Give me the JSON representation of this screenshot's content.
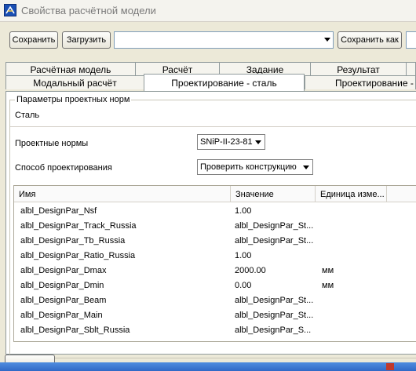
{
  "window": {
    "title": "Свойства расчётной модели",
    "icon": "model-properties-icon"
  },
  "toolbar": {
    "save_label": "Сохранить",
    "load_label": "Загрузить",
    "preset_value": "",
    "save_as_label": "Сохранить как"
  },
  "tabs": {
    "top": [
      "Расчётная модель",
      "Расчёт",
      "Задание",
      "Результат"
    ],
    "bottom": [
      "Модальный расчёт",
      "Проектирование - сталь",
      "Проектирование - бе"
    ],
    "active": "Проектирование - сталь"
  },
  "group": {
    "title": "Параметры проектных норм",
    "material": "Сталь"
  },
  "fields": {
    "norms_label": "Проектные нормы",
    "norms_value": "SNiP-II-23-81",
    "method_label": "Способ проектирования",
    "method_value": "Проверить конструкцию"
  },
  "grid": {
    "columns": [
      "Имя",
      "Значение",
      "Единица изме..."
    ],
    "rows": [
      {
        "name": "albl_DesignPar_Nsf",
        "value": "1.00",
        "unit": ""
      },
      {
        "name": "albl_DesignPar_Track_Russia",
        "value": "albl_DesignPar_St...",
        "unit": ""
      },
      {
        "name": "albl_DesignPar_Tb_Russia",
        "value": "albl_DesignPar_St...",
        "unit": ""
      },
      {
        "name": "albl_DesignPar_Ratio_Russia",
        "value": "1.00",
        "unit": ""
      },
      {
        "name": "albl_DesignPar_Dmax",
        "value": "2000.00",
        "unit": "мм"
      },
      {
        "name": "albl_DesignPar_Dmin",
        "value": "0.00",
        "unit": "мм"
      },
      {
        "name": "albl_DesignPar_Beam",
        "value": "albl_DesignPar_St...",
        "unit": ""
      },
      {
        "name": "albl_DesignPar_Main",
        "value": "albl_DesignPar_St...",
        "unit": ""
      },
      {
        "name": "albl_DesignPar_Sblt_Russia",
        "value": "albl_DesignPar_S...",
        "unit": ""
      }
    ]
  },
  "colors": {
    "window_bg": "#ece9d8",
    "panel_bg": "#ffffff",
    "taskbar": "#3169c6"
  }
}
